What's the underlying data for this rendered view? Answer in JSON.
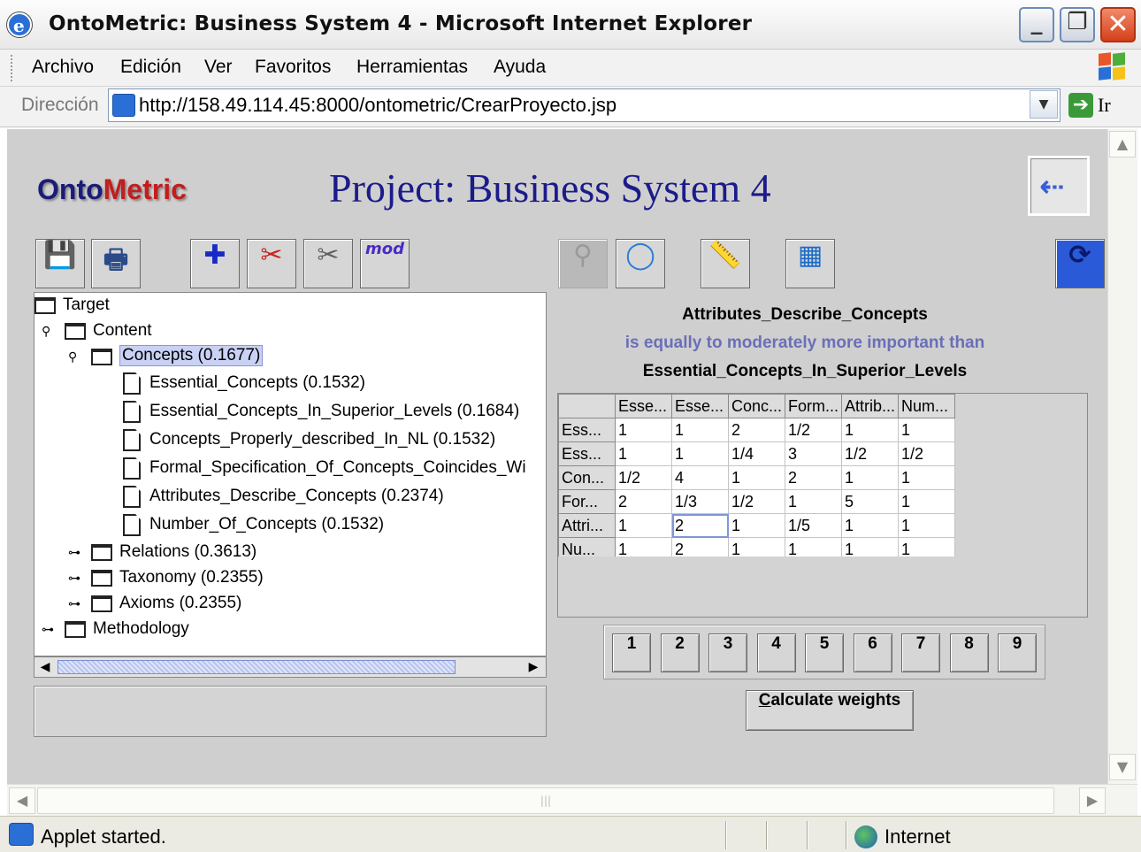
{
  "window": {
    "title": "OntoMetric: Business System 4 - Microsoft Internet Explorer",
    "minimize": "_",
    "maximize": "❐",
    "close": "✕"
  },
  "menu": [
    "Archivo",
    "Edición",
    "Ver",
    "Favoritos",
    "Herramientas",
    "Ayuda"
  ],
  "address": {
    "label": "Dirección",
    "url": "http://158.49.114.45:8000/ontometric/CrearProyecto.jsp",
    "go_label": "Ir"
  },
  "applet": {
    "logo_prefix": "Onto",
    "logo_suffix": "Metric",
    "project_title": "Project: Business System 4",
    "toolbar_left": [
      {
        "name": "save-icon",
        "glyph": "💾",
        "color": "#1a2a8a"
      },
      {
        "name": "print-icon",
        "glyph": "🖶",
        "color": "#2a4a8a"
      },
      {
        "name": "add-icon",
        "glyph": "✚",
        "color": "#1a2ac8"
      },
      {
        "name": "delete-icon",
        "glyph": "✂",
        "color": "#c82020"
      },
      {
        "name": "remove-icon",
        "glyph": "✂",
        "color": "#606060"
      },
      {
        "name": "modify-icon",
        "glyph": "mod",
        "color": "#4a2ac8"
      }
    ],
    "toolbar_right": [
      {
        "name": "binoculars-icon",
        "glyph": "⚲",
        "color": "#9a9a9a",
        "disabled": true
      },
      {
        "name": "ring-icon",
        "glyph": "◯",
        "color": "#2a7ad8",
        "disabled": false
      },
      {
        "name": "ruler-icon",
        "glyph": "📏",
        "color": "#c89a20",
        "disabled": false
      },
      {
        "name": "calculator-icon",
        "glyph": "▦",
        "color": "#1a6ac8",
        "disabled": false
      },
      {
        "name": "refresh-icon",
        "glyph": "⟳",
        "color": "#1a1a8a",
        "disabled": false
      }
    ],
    "tree": [
      {
        "label": "Target",
        "type": "folder",
        "level": 0,
        "handle": ""
      },
      {
        "label": "Content",
        "type": "folder",
        "level": 1,
        "handle": "⚲"
      },
      {
        "label": "Concepts (0.1677)",
        "type": "folder",
        "level": 2,
        "handle": "⚲",
        "selected": true
      },
      {
        "label": "Essential_Concepts (0.1532)",
        "type": "doc",
        "level": 3,
        "handle": ""
      },
      {
        "label": "Essential_Concepts_In_Superior_Levels (0.1684)",
        "type": "doc",
        "level": 3,
        "handle": ""
      },
      {
        "label": "Concepts_Properly_described_In_NL (0.1532)",
        "type": "doc",
        "level": 3,
        "handle": ""
      },
      {
        "label": "Formal_Specification_Of_Concepts_Coincides_Wi",
        "type": "doc",
        "level": 3,
        "handle": ""
      },
      {
        "label": "Attributes_Describe_Concepts (0.2374)",
        "type": "doc",
        "level": 3,
        "handle": ""
      },
      {
        "label": "Number_Of_Concepts (0.1532)",
        "type": "doc",
        "level": 3,
        "handle": ""
      },
      {
        "label": "Relations (0.3613)",
        "type": "folder",
        "level": 2,
        "handle": "⊶"
      },
      {
        "label": "Taxonomy (0.2355)",
        "type": "folder",
        "level": 2,
        "handle": "⊶"
      },
      {
        "label": "Axioms (0.2355)",
        "type": "folder",
        "level": 2,
        "handle": "⊶"
      },
      {
        "label": "Methodology",
        "type": "folder",
        "level": 1,
        "handle": "⊶"
      }
    ],
    "comparison": {
      "left": "Attributes_Describe_Concepts",
      "phrase": "is equally to moderately more important than",
      "right": "Essential_Concepts_In_Superior_Levels"
    },
    "matrix": {
      "columns": [
        "Esse...",
        "Esse...",
        "Conc...",
        "Form...",
        "Attrib...",
        "Num..."
      ],
      "rows": [
        {
          "label": "Ess...",
          "values": [
            "1",
            "1",
            "2",
            "1/2",
            "1",
            "1"
          ]
        },
        {
          "label": "Ess...",
          "values": [
            "1",
            "1",
            "1/4",
            "3",
            "1/2",
            "1/2"
          ]
        },
        {
          "label": "Con...",
          "values": [
            "1/2",
            "4",
            "1",
            "2",
            "1",
            "1"
          ]
        },
        {
          "label": "For...",
          "values": [
            "2",
            "1/3",
            "1/2",
            "1",
            "5",
            "1"
          ]
        },
        {
          "label": "Attri...",
          "values": [
            "1",
            "2",
            "1",
            "1/5",
            "1",
            "1"
          ]
        },
        {
          "label": "Nu...",
          "values": [
            "1",
            "2",
            "1",
            "1",
            "1",
            "1"
          ]
        }
      ]
    },
    "scale": [
      "1",
      "2",
      "3",
      "4",
      "5",
      "6",
      "7",
      "8",
      "9"
    ],
    "calculate_label": "Calculate weights",
    "calculate_mnemonic": "C"
  },
  "status": {
    "text": "Applet started.",
    "zone": "Internet"
  },
  "colors": {
    "title_blue": "#1b1b8a",
    "phrase_color": "#6a6fb8",
    "selection": "#c9d1f5"
  }
}
